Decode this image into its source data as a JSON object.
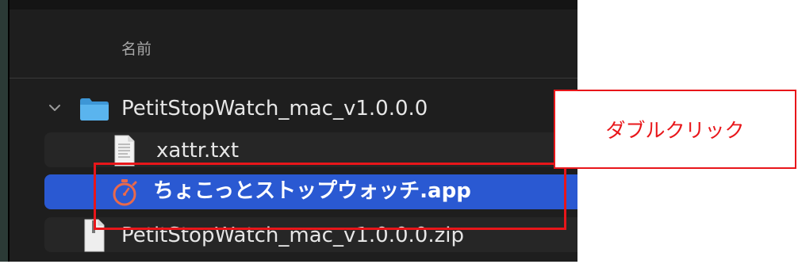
{
  "finder": {
    "column_header": "名前",
    "rows": [
      {
        "name": "PetitStopWatch_mac_v1.0.0.0",
        "kind": "folder",
        "icon": "folder-icon",
        "expanded": true
      },
      {
        "name": "xattr.txt",
        "kind": "text-file",
        "icon": "text-file-icon"
      },
      {
        "name": "ちょこっとストップウォッチ.app",
        "kind": "application",
        "icon": "stopwatch-app-icon",
        "selected": true
      },
      {
        "name": "PetitStopWatch_mac_v1.0.0.0.zip",
        "kind": "zip-archive",
        "icon": "zip-file-icon"
      }
    ]
  },
  "annotation": {
    "label": "ダブルクリック",
    "color": "#e8161a"
  },
  "colors": {
    "selection": "#2a59d2",
    "window_background": "#1e1e1e",
    "folder": "#4aa7e8"
  }
}
